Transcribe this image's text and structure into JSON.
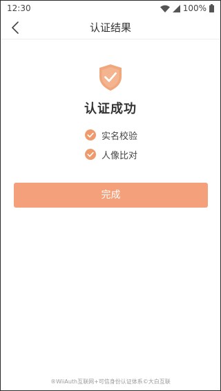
{
  "status_bar": {
    "time": "12:30",
    "battery": "100%",
    "icons": [
      "wifi-icon",
      "signal-icon",
      "battery-icon"
    ]
  },
  "nav": {
    "back_icon": "chevron-left-icon",
    "title": "认证结果"
  },
  "result": {
    "icon": "shield-check-icon",
    "title": "认证成功",
    "checks": [
      {
        "label": "实名校验",
        "icon": "check-circle-icon"
      },
      {
        "label": "人像比对",
        "icon": "check-circle-icon"
      }
    ]
  },
  "actions": {
    "done_label": "完成"
  },
  "footer": {
    "text": "®WiiAuth互联网+可信身份认证体系©大白互联"
  },
  "colors": {
    "accent": "#f4a07a",
    "check": "#ee9a6c",
    "shield": "#f0a77c"
  }
}
